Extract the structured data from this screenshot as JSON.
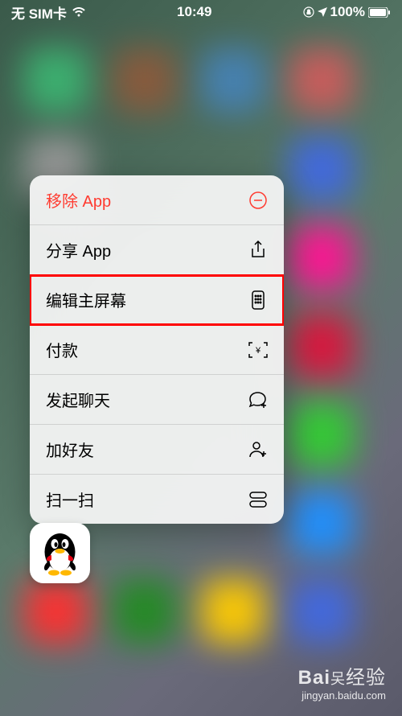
{
  "status_bar": {
    "sim": "无 SIM卡",
    "time": "10:49",
    "battery": "100%"
  },
  "menu": {
    "remove_app": "移除 App",
    "share_app": "分享 App",
    "edit_home": "编辑主屏幕",
    "payment": "付款",
    "start_chat": "发起聊天",
    "add_friend": "加好友",
    "scan": "扫一扫"
  },
  "app": {
    "name": "QQ"
  },
  "watermark": {
    "brand_prefix": "Bai",
    "brand_suffix": "经验",
    "url": "jingyan.baidu.com"
  }
}
